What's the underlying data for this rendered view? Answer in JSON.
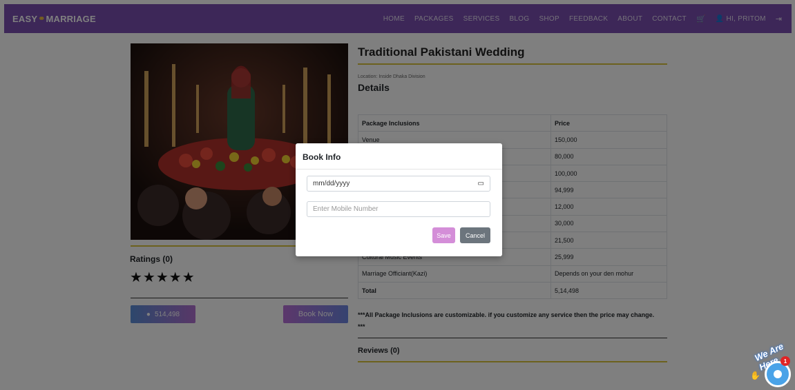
{
  "navbar": {
    "brand_left": "EASY",
    "brand_right": "MARRIAGE",
    "links": [
      "HOME",
      "PACKAGES",
      "SERVICES",
      "BLOG",
      "SHOP",
      "FEEDBACK",
      "ABOUT",
      "CONTACT"
    ],
    "user_label": "HI, PRITOM"
  },
  "package": {
    "title": "Traditional Pakistani Wedding",
    "location": "Location: Inside Dhaka Division",
    "details_heading": "Details",
    "table_headers": [
      "Package Inclusions",
      "Price"
    ],
    "rows": [
      {
        "item": "Venue",
        "price": "150,000"
      },
      {
        "item": "",
        "price": "80,000"
      },
      {
        "item": "",
        "price": "100,000"
      },
      {
        "item": "",
        "price": "94,999"
      },
      {
        "item": "",
        "price": "12,000"
      },
      {
        "item": "",
        "price": "30,000"
      },
      {
        "item": "",
        "price": "21,500"
      },
      {
        "item": "Cultural Music Events",
        "price": "25,999"
      },
      {
        "item": "Marriage Officiant(Kazi)",
        "price": "Depends on your den mohur"
      }
    ],
    "total_label": "Total",
    "total_value": "5,14,498",
    "note": "***All Package Inclusions are customizable. if you customize any service then the price may change. ***",
    "reviews": "Reviews (0)"
  },
  "sidebar": {
    "ratings": "Ratings (0)",
    "stars": "★★★★★",
    "price_button": "514,498",
    "book_button": "Book Now"
  },
  "modal": {
    "title": "Book Info",
    "date_value": "mm/dd/yyyy",
    "mobile_placeholder": "Enter Mobile Number",
    "save_label": "Save",
    "cancel_label": "Cancel"
  },
  "chat_widget": {
    "text": "We Are Here",
    "badge": "1"
  },
  "colors": {
    "navbar": "#7a4fb1",
    "gold": "#d9c23a",
    "save": "#d48ed8",
    "cancel": "#6c757d"
  }
}
